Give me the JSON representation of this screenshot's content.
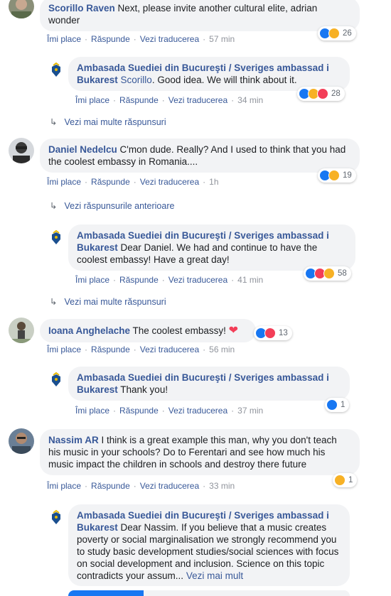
{
  "actions": {
    "like": "Îmi place",
    "reply": "Răspunde",
    "translate": "Vezi traducerea"
  },
  "comments": [
    {
      "author": "Scorillo Raven",
      "text": " Next, please invite another cultural elite, adrian wonder",
      "time": "57 min",
      "reactions": "26"
    },
    {
      "author": "Ambasada Suediei din Bucureşti / Sveriges ambassad i Bukarest",
      "mention": "Scorillo",
      "text": ". Good idea. We will think about it.",
      "time": "34 min",
      "reactions": "28"
    },
    {
      "author": "Daniel Nedelcu",
      "text": " C'mon dude. Really? And I used to think that you had the coolest embassy in Romania....",
      "time": "1h",
      "reactions": "19"
    },
    {
      "author": "Ambasada Suediei din Bucureşti / Sveriges ambassad i Bukarest",
      "text": " Dear Daniel. We had and continue to have the coolest embassy! Have a great day!",
      "time": "41 min",
      "reactions": "58"
    },
    {
      "author": "Ioana Anghelache",
      "text": " The coolest embassy! ",
      "time": "56 min",
      "reactions": "13"
    },
    {
      "author": "Ambasada Suediei din Bucureşti / Sveriges ambassad i Bukarest",
      "text": " Thank you!",
      "time": "37 min",
      "reactions": "1"
    },
    {
      "author": "Nassim AR",
      "text": " I think is a great example this man, why you don't teach his music in your schools? Do to Ferentari and see how much his music impact the children in schools and destroy there future",
      "time": "33 min",
      "reactions": "1"
    },
    {
      "author": "Ambasada Suediei din Bucureşti / Sveriges ambassad i Bukarest",
      "text": " Dear Nassim. If you believe that a music creates poverty or social marginalisation we strongly recommend you to study basic development studies/social sciences with focus on social development and inclusion. Science on this topic contradicts your assum...",
      "more": "Vezi mai mult"
    }
  ],
  "links": {
    "more_replies": "Vezi mai multe răspunsuri",
    "previous_replies": "Vezi răspunsurile anterioare"
  },
  "icons": {
    "arrow": "↳",
    "heart": "❤"
  },
  "colors": {
    "link": "#385898",
    "bubble": "#f2f3f5",
    "like": "#1877f2",
    "haha": "#f7b125",
    "love": "#f33e58"
  }
}
